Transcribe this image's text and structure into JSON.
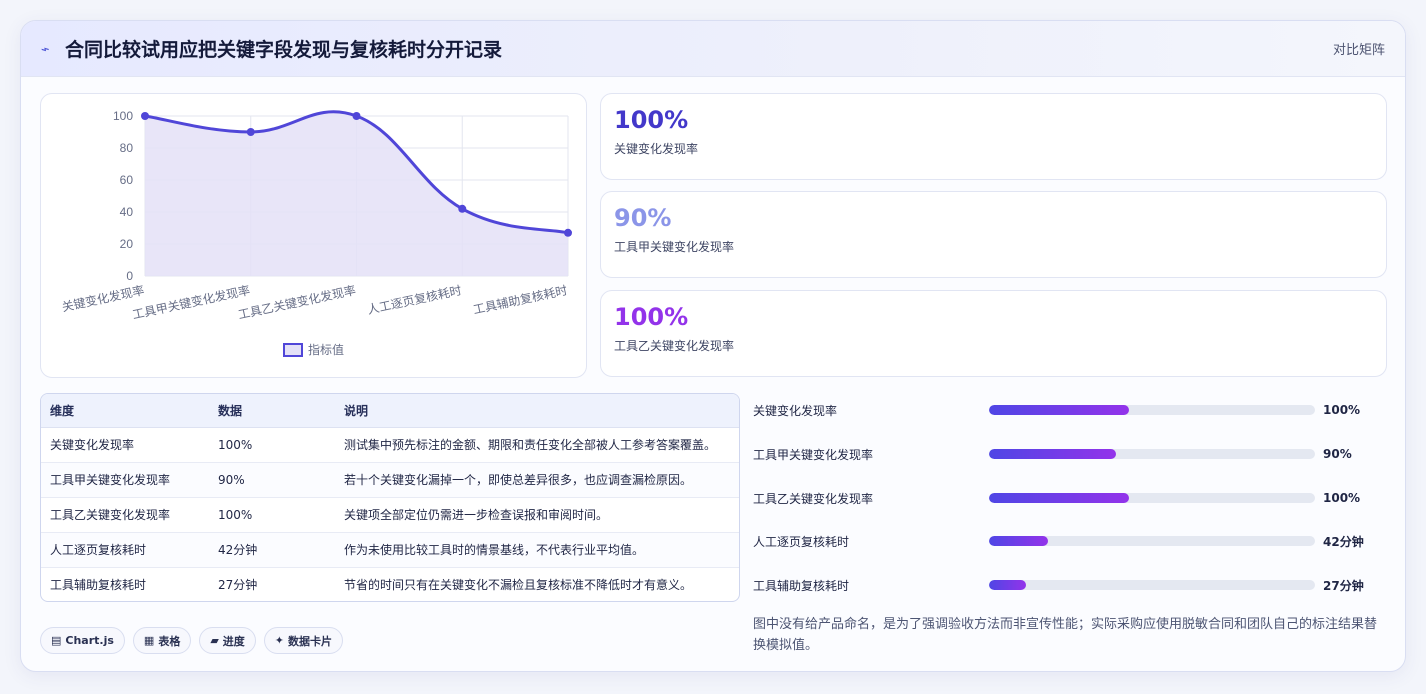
{
  "header": {
    "title": "合同比较试用应把关键字段发现与复核耗时分开记录",
    "action": "对比矩阵"
  },
  "chart_data": {
    "type": "line",
    "categories": [
      "关键变化发现率",
      "工具甲关键变化发现率",
      "工具乙关键变化发现率",
      "人工逐页复核耗时",
      "工具辅助复核耗时"
    ],
    "series": [
      {
        "name": "指标值",
        "values": [
          100,
          90,
          100,
          42,
          27
        ]
      }
    ],
    "ylim": [
      0,
      100
    ],
    "yticks": [
      0,
      20,
      40,
      60,
      80,
      100
    ],
    "legend": "bottom",
    "grid": true,
    "colors": {
      "line": "#5046d8",
      "fill": "#e4e1f7"
    }
  },
  "metrics": [
    {
      "value": "100%",
      "label": "关键变化发现率",
      "color": "#4338ca"
    },
    {
      "value": "90%",
      "label": "工具甲关键变化发现率",
      "color": "#8b95e8"
    },
    {
      "value": "100%",
      "label": "工具乙关键变化发现率",
      "color": "#9333ea"
    }
  ],
  "table": {
    "headers": [
      "维度",
      "数据",
      "说明"
    ],
    "rows": [
      [
        "关键变化发现率",
        "100%",
        "测试集中预先标注的金额、期限和责任变化全部被人工参考答案覆盖。"
      ],
      [
        "工具甲关键变化发现率",
        "90%",
        "若十个关键变化漏掉一个，即使总差异很多，也应调查漏检原因。"
      ],
      [
        "工具乙关键变化发现率",
        "100%",
        "关键项全部定位仍需进一步检查误报和审阅时间。"
      ],
      [
        "人工逐页复核耗时",
        "42分钟",
        "作为未使用比较工具时的情景基线，不代表行业平均值。"
      ],
      [
        "工具辅助复核耗时",
        "27分钟",
        "节省的时间只有在关键变化不漏检且复核标准不降低时才有意义。"
      ]
    ]
  },
  "progress": [
    {
      "label": "关键变化发现率",
      "value": "100%",
      "fraction": 0.43
    },
    {
      "label": "工具甲关键变化发现率",
      "value": "90%",
      "fraction": 0.39
    },
    {
      "label": "工具乙关键变化发现率",
      "value": "100%",
      "fraction": 0.43
    },
    {
      "label": "人工逐页复核耗时",
      "value": "42分钟",
      "fraction": 0.18
    },
    {
      "label": "工具辅助复核耗时",
      "value": "27分钟",
      "fraction": 0.115
    }
  ],
  "note": "图中没有给产品命名，是为了强调验收方法而非宣传性能；实际采购应使用脱敏合同和团队自己的标注结果替换模拟值。",
  "chips": [
    {
      "icon": "▤",
      "label": "Chart.js"
    },
    {
      "icon": "▦",
      "label": "表格"
    },
    {
      "icon": "▰",
      "label": "进度"
    },
    {
      "icon": "✦",
      "label": "数据卡片"
    }
  ]
}
